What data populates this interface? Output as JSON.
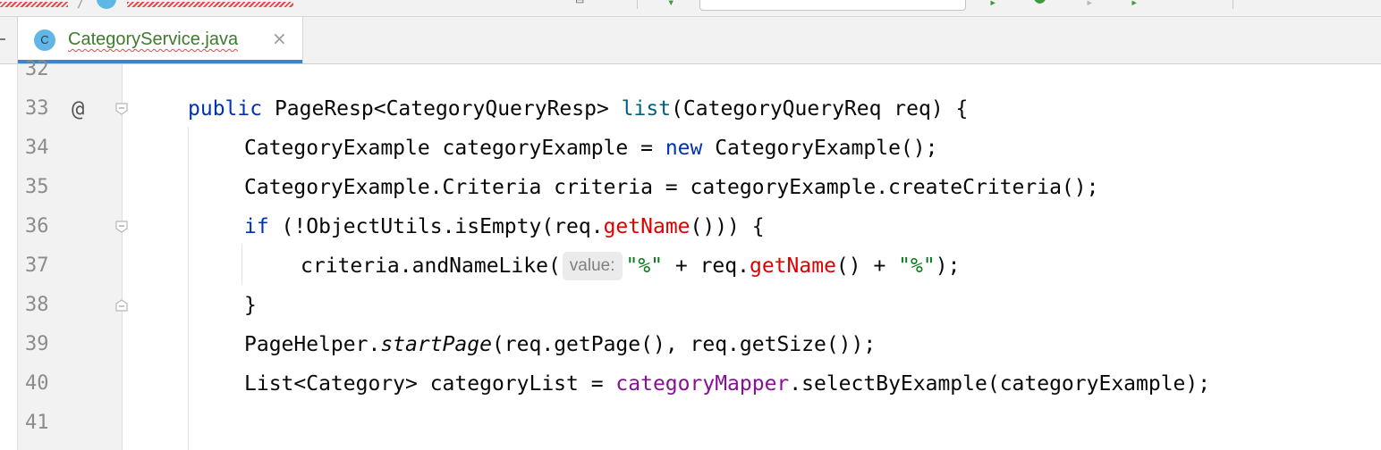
{
  "tab": {
    "file_icon": "C",
    "title": "CategoryService.java",
    "close_glyph": "×"
  },
  "gutter": {
    "override_icon": "@"
  },
  "code": {
    "lines": [
      {
        "num": "32"
      },
      {
        "num": "33",
        "t1": "public",
        "t2": " PageResp<CategoryQueryResp> ",
        "t3": "list",
        "t4": "(CategoryQueryReq req) {"
      },
      {
        "num": "34",
        "t1": "CategoryExample categoryExample = ",
        "t2": "new",
        "t3": " CategoryExample();"
      },
      {
        "num": "35",
        "t1": "CategoryExample.Criteria criteria = categoryExample.createCriteria();"
      },
      {
        "num": "36",
        "t1": "if",
        "t2": " (!ObjectUtils.isEmpty(req.",
        "t3": "getName",
        "t4": "())) {"
      },
      {
        "num": "37",
        "t1": "criteria.andNameLike(",
        "hint": "value:",
        "t2": "\"%\"",
        "t3": " + req.",
        "t4": "getName",
        "t5": "() + ",
        "t6": "\"%\"",
        "t7": ");"
      },
      {
        "num": "38",
        "t1": "}"
      },
      {
        "num": "39",
        "t1": "PageHelper.",
        "t2": "startPage",
        "t3": "(req.getPage(), req.getSize());"
      },
      {
        "num": "40",
        "t1": "List<Category> categoryList = ",
        "t2": "categoryMapper",
        "t3": ".selectByExample(categoryExample);"
      },
      {
        "num": "41"
      }
    ]
  }
}
